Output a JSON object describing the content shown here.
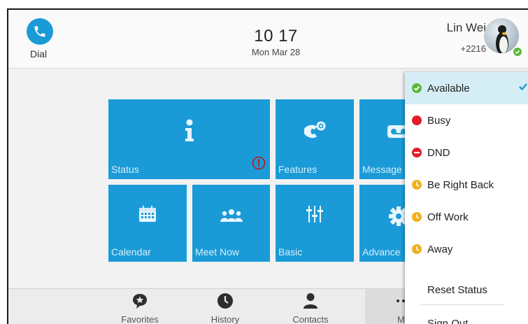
{
  "header": {
    "dial_label": "Dial",
    "time": "10 17",
    "date": "Mon Mar 28",
    "user_name": "Lin Wei",
    "extension": "+2216"
  },
  "tiles": [
    {
      "label": "Status",
      "icon": "info-icon"
    },
    {
      "label": "Features",
      "icon": "phone-gear-icon"
    },
    {
      "label": "Message",
      "icon": "voicemail-icon"
    },
    {
      "label": "Calendar",
      "icon": "calendar-icon"
    },
    {
      "label": "Meet Now",
      "icon": "group-icon"
    },
    {
      "label": "Basic",
      "icon": "sliders-icon"
    },
    {
      "label": "Advance",
      "icon": "gear-icon"
    }
  ],
  "bottom_bar": {
    "favorites": "Favorites",
    "history": "History",
    "contacts": "Contacts",
    "more": "Me"
  },
  "status_menu": {
    "items": [
      {
        "label": "Available",
        "color": "#5bb738",
        "selected": true
      },
      {
        "label": "Busy",
        "color": "#e11d2a"
      },
      {
        "label": "DND",
        "color": "#e11d2a"
      },
      {
        "label": "Be Right Back",
        "color": "#f2b01e"
      },
      {
        "label": "Off Work",
        "color": "#f2b01e"
      },
      {
        "label": "Away",
        "color": "#f2b01e"
      }
    ],
    "reset": "Reset Status",
    "sign_out": "Sign Out"
  },
  "colors": {
    "accent": "#1a9bd7",
    "selected_row": "#d5edf4"
  }
}
